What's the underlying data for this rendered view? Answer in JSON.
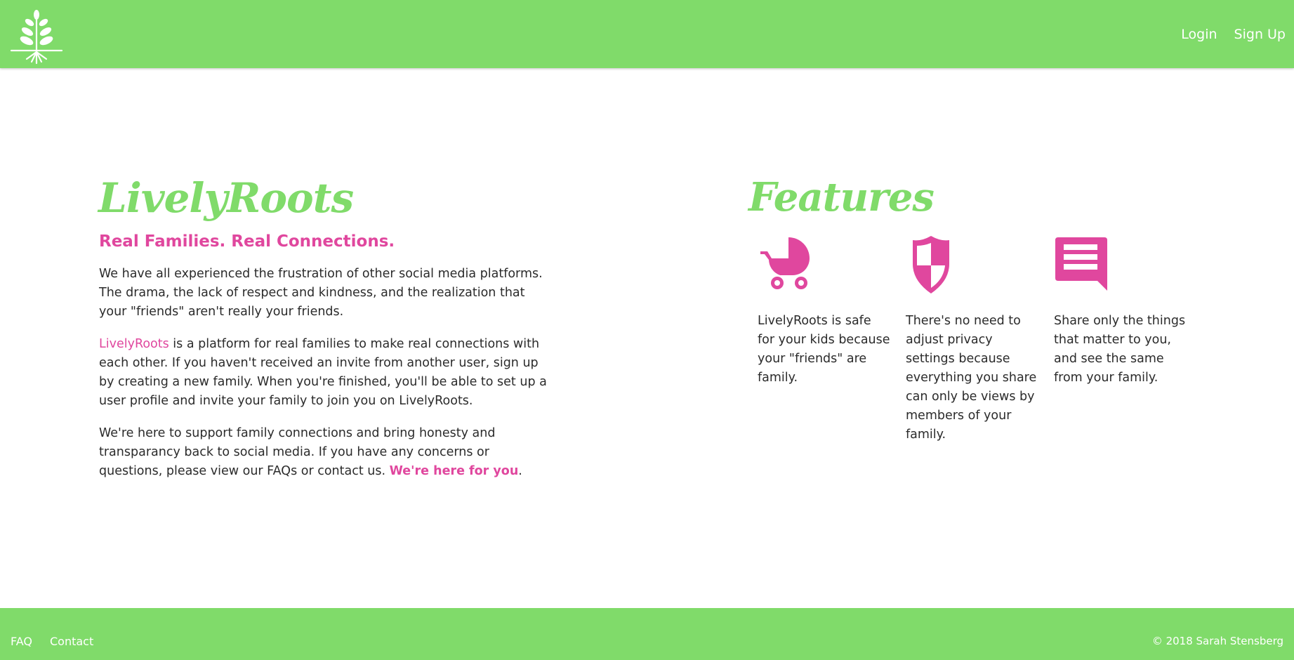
{
  "nav": {
    "login_label": "Login",
    "signup_label": "Sign Up",
    "logo_icon": "tree-roots-logo-icon"
  },
  "intro": {
    "brand_title": "LivelyRoots",
    "tagline": "Real Families. Real Connections.",
    "paragraph1": "We have all experienced the frustration of other social media platforms. The drama, the lack of respect and kindness, and the realization that your \"friends\" aren't really your friends.",
    "paragraph2_brand": "LivelyRoots",
    "paragraph2_rest": " is a platform for real families to make real connections with each other. If you haven't received an invite from another user, sign up by creating a new family. When you're finished, you'll be able to set up a user profile and invite your family to join you on LivelyRoots.",
    "paragraph3_text": "We're here to support family connections and bring honesty and transparancy back to social media. If you have any concerns or questions, please view our FAQs or contact us. ",
    "paragraph3_link": "We're here for you",
    "paragraph3_end": "."
  },
  "features": {
    "title": "Features",
    "items": [
      {
        "icon": "stroller-icon",
        "text": "LivelyRoots is safe for your kids because your \"friends\" are family."
      },
      {
        "icon": "shield-icon",
        "text": "There's no need to adjust privacy settings because everything you share can only be views by members of your family."
      },
      {
        "icon": "chat-bubble-icon",
        "text": "Share only the things that matter to you, and see the same from your family."
      }
    ]
  },
  "footer": {
    "faq_label": "FAQ",
    "contact_label": "Contact",
    "copyright": "© 2018 Sarah Stensberg"
  },
  "colors": {
    "brand_green": "#80db6a",
    "accent_pink": "#e0479e"
  }
}
